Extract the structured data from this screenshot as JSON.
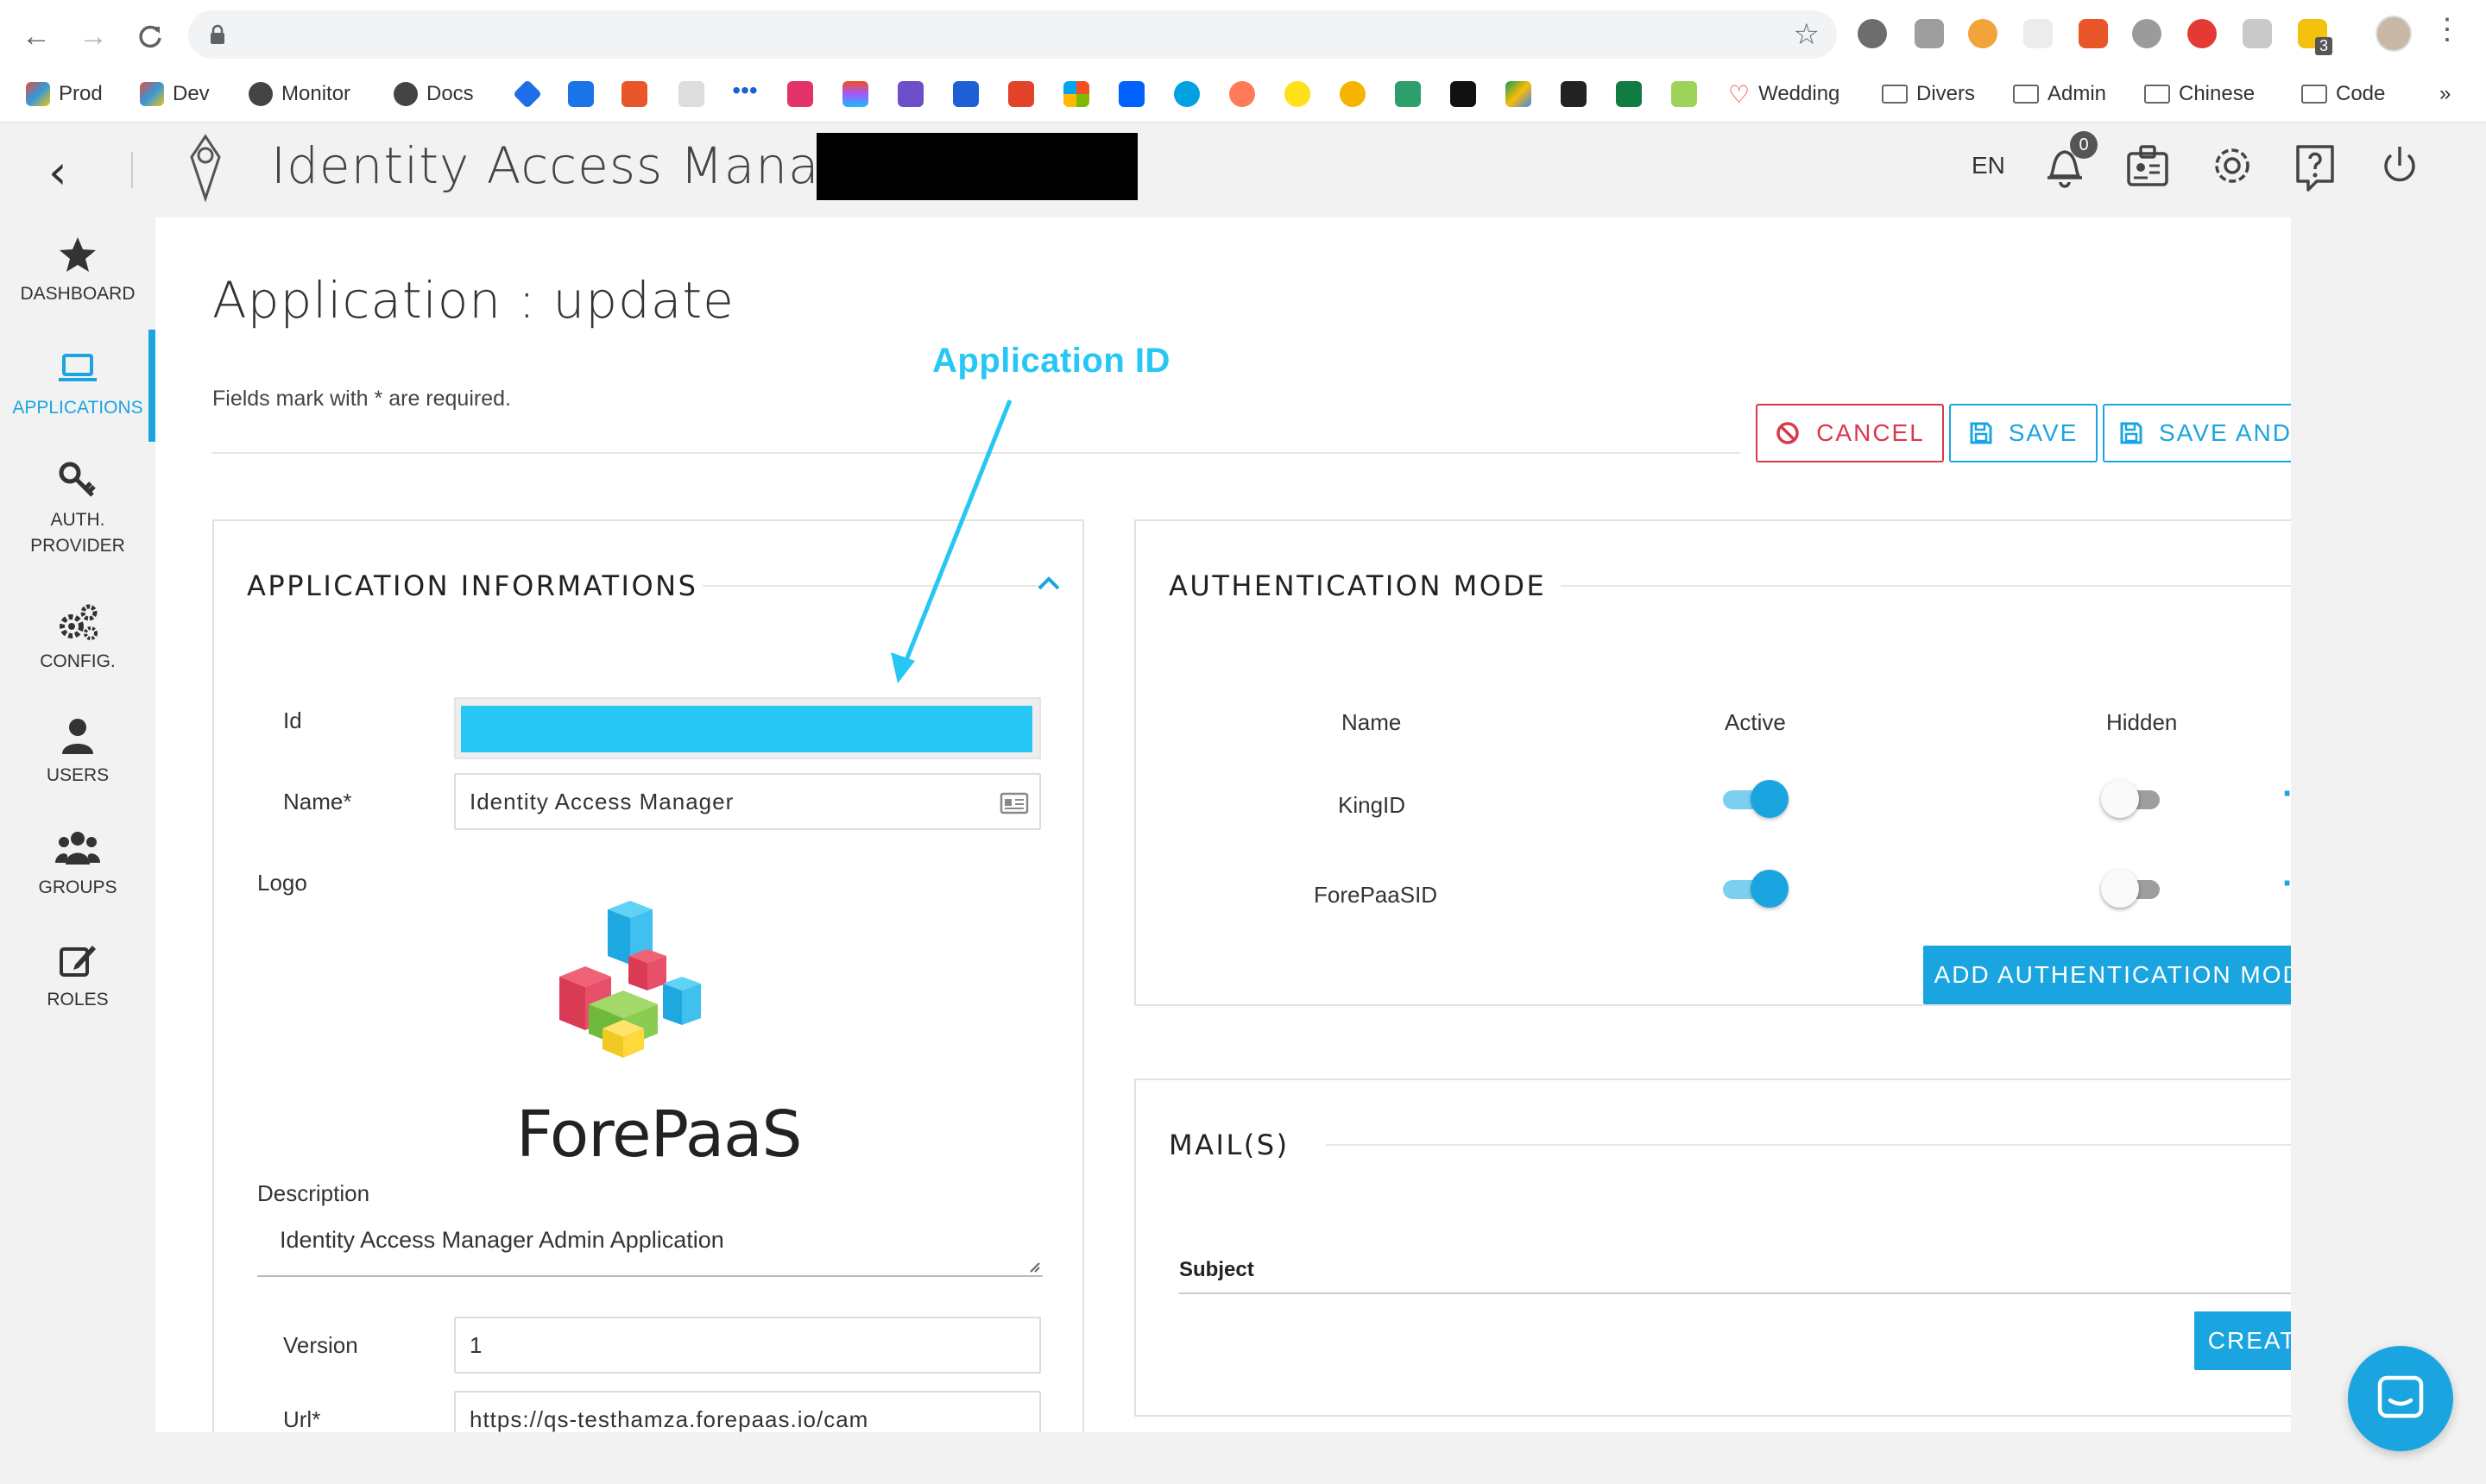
{
  "browser": {
    "bookmarks": [
      {
        "label": "Prod"
      },
      {
        "label": "Dev"
      },
      {
        "label": "Monitor"
      },
      {
        "label": "Docs"
      },
      {
        "label": "Wedding"
      },
      {
        "label": "Divers"
      },
      {
        "label": "Admin"
      },
      {
        "label": "Chinese"
      },
      {
        "label": "Code"
      }
    ],
    "overflow": "»",
    "extension_badge": "3"
  },
  "header": {
    "title": "Identity Access Manager -",
    "lang": "EN",
    "notifications": "0"
  },
  "sidebar": {
    "items": [
      {
        "label": "DASHBOARD",
        "icon": "star-icon"
      },
      {
        "label": "APPLICATIONS",
        "icon": "laptop-icon",
        "active": true
      },
      {
        "label": "AUTH.",
        "label2": "PROVIDER",
        "icon": "key-icon"
      },
      {
        "label": "CONFIG.",
        "icon": "gears-icon"
      },
      {
        "label": "USERS",
        "icon": "user-icon"
      },
      {
        "label": "GROUPS",
        "icon": "users-icon"
      },
      {
        "label": "ROLES",
        "icon": "edit-icon"
      }
    ]
  },
  "page": {
    "title": "Application : update",
    "required_note": "Fields mark with * are required.",
    "cancel": "CANCEL",
    "save": "SAVE",
    "save_exit": "SAVE AND EXIT"
  },
  "annotation": {
    "label": "Application ID"
  },
  "app_info": {
    "title": "APPLICATION INFORMATIONS",
    "id_label": "Id",
    "name_label": "Name*",
    "name_value": "Identity Access Manager",
    "logo_label": "Logo",
    "logo_text": "ForePaaS",
    "description_label": "Description",
    "description_value": "Identity Access Manager Admin Application",
    "version_label": "Version",
    "version_value": "1",
    "url_label": "Url*",
    "url_value": "https://qs-testhamza.forepaas.io/cam"
  },
  "auth_mode": {
    "title": "AUTHENTICATION MODE",
    "col_name": "Name",
    "col_active": "Active",
    "col_hidden": "Hidden",
    "rows": [
      {
        "name": "KingID",
        "active": true,
        "hidden": false
      },
      {
        "name": "ForePaaSID",
        "active": true,
        "hidden": false
      }
    ],
    "add_button": "ADD AUTHENTICATION MODE"
  },
  "mails": {
    "title": "MAIL(S)",
    "col_subject": "Subject",
    "create_button": "CREATE NEW EMAIL"
  },
  "colors": {
    "accent": "#1aa5e0",
    "danger": "#d9394b",
    "annotation": "#26c6f5"
  }
}
